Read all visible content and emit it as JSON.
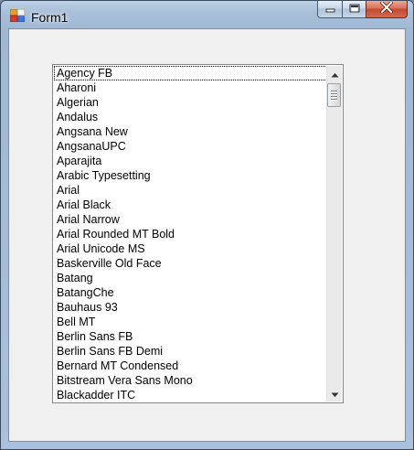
{
  "window": {
    "title": "Form1",
    "icons": {
      "app": "winforms-app-icon",
      "minimize": "minimize-icon",
      "maximize": "maximize-icon",
      "close": "close-icon"
    }
  },
  "listbox": {
    "focused_index": 0,
    "items": [
      "Agency FB",
      "Aharoni",
      "Algerian",
      "Andalus",
      "Angsana New",
      "AngsanaUPC",
      "Aparajita",
      "Arabic Typesetting",
      "Arial",
      "Arial Black",
      "Arial Narrow",
      "Arial Rounded MT Bold",
      "Arial Unicode MS",
      "Baskerville Old Face",
      "Batang",
      "BatangChe",
      "Bauhaus 93",
      "Bell MT",
      "Berlin Sans FB",
      "Berlin Sans FB Demi",
      "Bernard MT Condensed",
      "Bitstream Vera Sans Mono",
      "Blackadder ITC"
    ],
    "scrollbar": {
      "up_icon": "scroll-up-arrow-icon",
      "down_icon": "scroll-down-arrow-icon",
      "position": 0
    }
  },
  "colors": {
    "client_background": "#f0f0f0",
    "list_background": "#ffffff",
    "close_button": "#c34a30",
    "frame": "#a9c0da"
  }
}
